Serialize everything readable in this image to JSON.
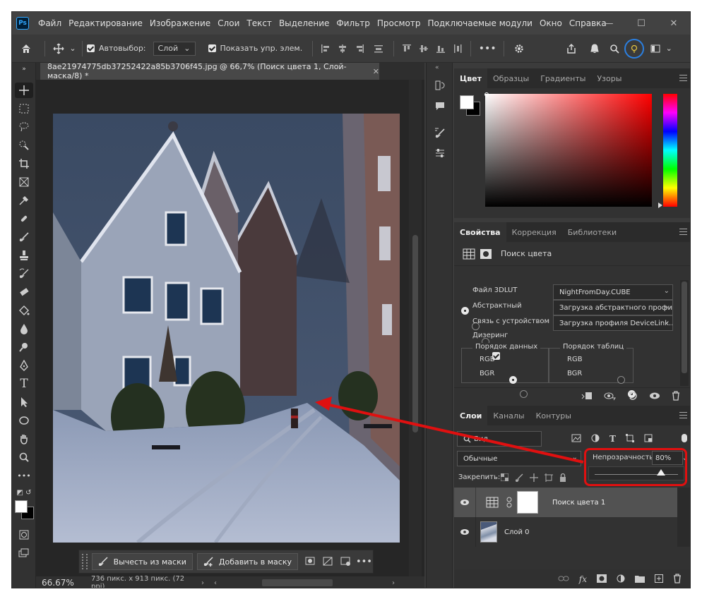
{
  "app": {
    "logo": "Ps"
  },
  "menu": [
    "Файл",
    "Редактирование",
    "Изображение",
    "Слои",
    "Текст",
    "Выделение",
    "Фильтр",
    "Просмотр",
    "Подключаемые модули",
    "Окно",
    "Справка"
  ],
  "window_controls": {
    "minimize": "—",
    "maximize": "☐",
    "close": "✕"
  },
  "options": {
    "autoselect_label": "Автовыбор:",
    "autoselect_value": "Слой",
    "show_controls_label": "Показать упр. элем."
  },
  "document": {
    "tab_title": "8ae21974775db37252422a85b3706f45.jpg @ 66,7% (Поиск цвета 1, Слой-маска/8) *",
    "zoom": "66.67%",
    "info": "736 пикс. x 913 пикс. (72 ppi)"
  },
  "context_bar": {
    "subtract_label": "Вычесть из маски",
    "add_label": "Добавить в маску"
  },
  "color_panel": {
    "tabs": [
      "Цвет",
      "Образцы",
      "Градиенты",
      "Узоры"
    ],
    "hue_color": "#ff0000"
  },
  "properties_panel": {
    "tabs": [
      "Свойства",
      "Коррекция",
      "Библиотеки"
    ],
    "header": "Поиск цвета",
    "options": [
      {
        "label": "Файл 3DLUT",
        "value": "NightFromDay.CUBE",
        "selected": true
      },
      {
        "label": "Абстрактный",
        "value": "Загрузка абстрактного профи...",
        "selected": false
      },
      {
        "label": "Связь с устройством",
        "value": "Загрузка профиля DeviceLink...",
        "selected": false
      }
    ],
    "dither_label": "Дизеринг",
    "data_order": {
      "title": "Порядок данных",
      "options": [
        "RGB",
        "BGR"
      ],
      "selected": "RGB"
    },
    "table_order": {
      "title": "Порядок таблиц",
      "options": [
        "RGB",
        "BGR"
      ],
      "selected": "BGR"
    }
  },
  "layers_panel": {
    "tabs": [
      "Слои",
      "Каналы",
      "Контуры"
    ],
    "filter_label": "Вид",
    "blend_mode": "Обычные",
    "opacity_label": "Непрозрачность:",
    "opacity_value": "80%",
    "opacity_fraction": 0.8,
    "lock_label": "Закрепить:",
    "layers": [
      {
        "name": "Поиск цвета 1",
        "selected": true
      },
      {
        "name": "Слой 0",
        "selected": false
      }
    ]
  }
}
